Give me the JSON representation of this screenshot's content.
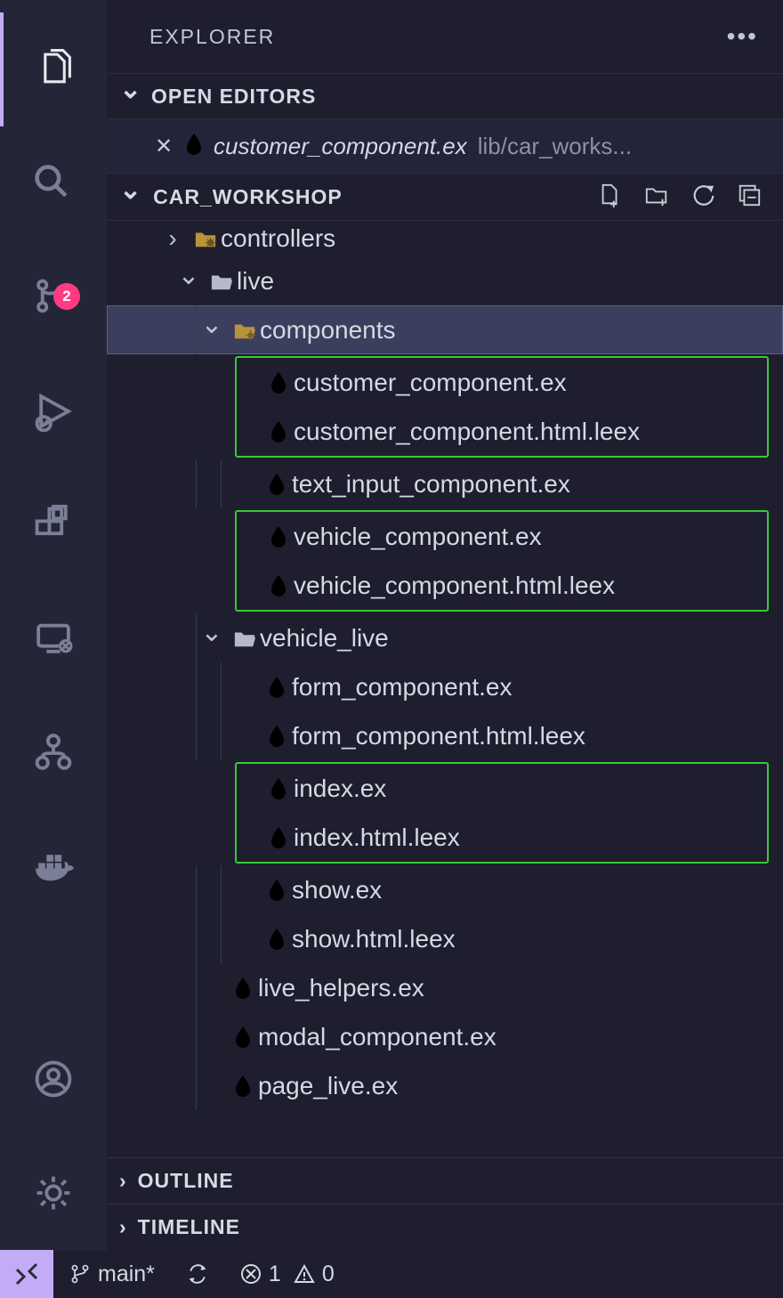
{
  "explorer": {
    "title": "EXPLORER"
  },
  "openEditors": {
    "title": "OPEN EDITORS",
    "file": {
      "name": "customer_component.ex",
      "path": "lib/car_works..."
    }
  },
  "workspace": {
    "title": "CAR_WORKSHOP"
  },
  "scm": {
    "badge": "2"
  },
  "tree": {
    "controllers": "controllers",
    "live": "live",
    "components": "components",
    "f1": "customer_component.ex",
    "f2": "customer_component.html.leex",
    "f3": "text_input_component.ex",
    "f4": "vehicle_component.ex",
    "f5": "vehicle_component.html.leex",
    "vehicle_live": "vehicle_live",
    "f6": "form_component.ex",
    "f7": "form_component.html.leex",
    "f8": "index.ex",
    "f9": "index.html.leex",
    "f10": "show.ex",
    "f11": "show.html.leex",
    "f12": "live_helpers.ex",
    "f13": "modal_component.ex",
    "f14": "page_live.ex"
  },
  "sections": {
    "outline": "OUTLINE",
    "timeline": "TIMELINE"
  },
  "status": {
    "branch": "main*",
    "errors": "1",
    "warnings": "0"
  }
}
